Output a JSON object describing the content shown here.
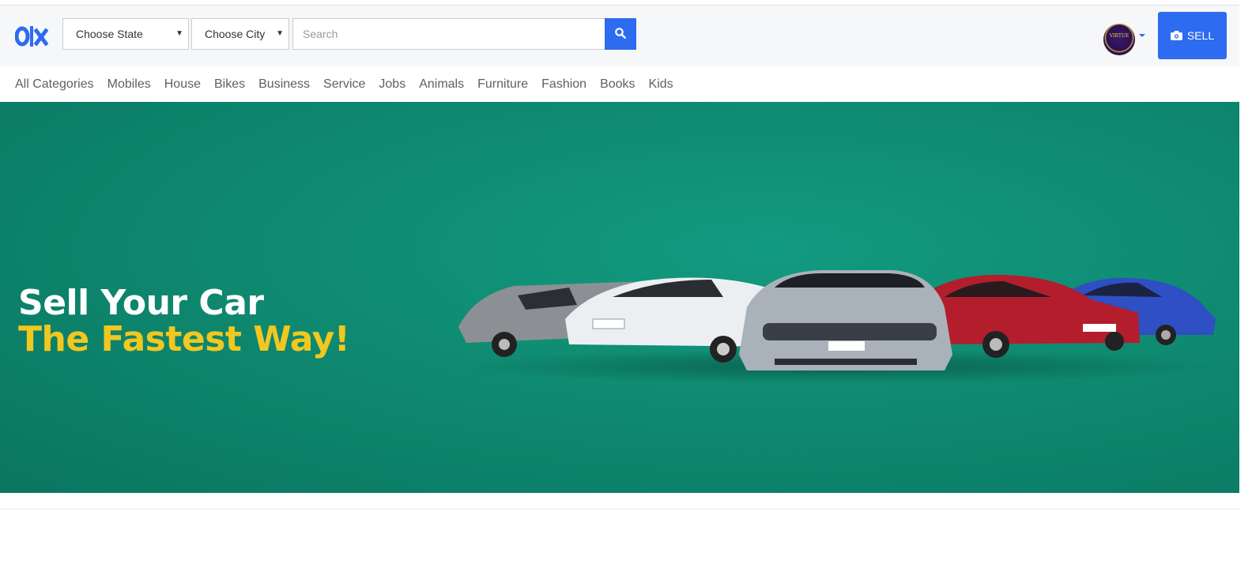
{
  "header": {
    "logo_text": "olx",
    "state_select": {
      "value": "Choose State"
    },
    "city_select": {
      "value": "Choose City"
    },
    "search": {
      "placeholder": "Search"
    },
    "search_icon": "search-icon",
    "avatar_text": "VIRTUE",
    "sell_label": "SELL",
    "sell_icon": "camera-icon",
    "accent_color": "#2d6bf0"
  },
  "nav": {
    "categories": [
      "All Categories",
      "Mobiles",
      "House",
      "Bikes",
      "Business",
      "Service",
      "Jobs",
      "Animals",
      "Furniture",
      "Fashion",
      "Books",
      "Kids"
    ]
  },
  "banner": {
    "line1": "Sell Your Car",
    "line2": "The Fastest Way!",
    "background_color": "#0f8c72",
    "highlight_color": "#f2c71f"
  }
}
